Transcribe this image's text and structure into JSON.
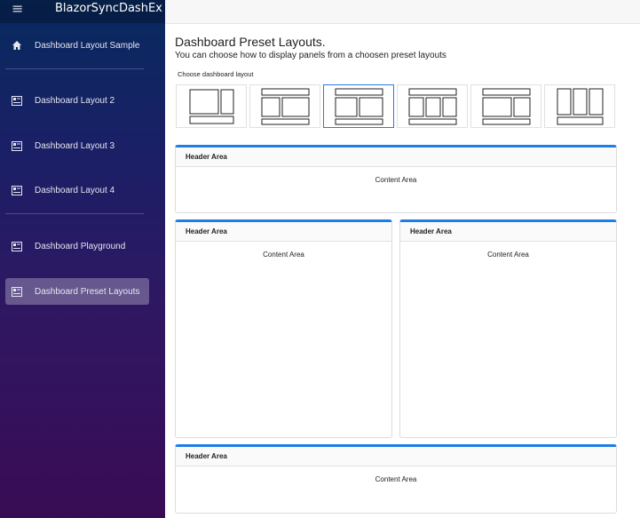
{
  "app": {
    "brand": "BlazorSyncDashEx",
    "menu_icon": "≡"
  },
  "sidebar": {
    "items": [
      {
        "label": "Dashboard Layout Sample",
        "icon": "home-icon",
        "active": false
      },
      {
        "label": "Dashboard Layout 2",
        "icon": "layout-icon",
        "active": false
      },
      {
        "label": "Dashboard Layout 3",
        "icon": "layout-icon",
        "active": false
      },
      {
        "label": "Dashboard Layout 4",
        "icon": "layout-icon",
        "active": false
      },
      {
        "label": "Dashboard Playground",
        "icon": "layout-icon",
        "active": false
      },
      {
        "label": "Dashboard Preset Layouts",
        "icon": "layout-icon",
        "active": true
      }
    ]
  },
  "main": {
    "title": "Dashboard Preset Layouts.",
    "subtitle": "You can choose how to display panels from a choosen preset layouts",
    "choose_label": "Choose dashboard layout",
    "selected_layout": 3,
    "panels": [
      {
        "header": "Header Area",
        "content": "Content Area"
      },
      {
        "header": "Header Area",
        "content": "Content Area"
      },
      {
        "header": "Header Area",
        "content": "Content Area"
      },
      {
        "header": "Header Area",
        "content": "Content Area"
      }
    ]
  },
  "colors": {
    "accent": "#1e7ee8",
    "selected_border": "#2b7be0"
  }
}
